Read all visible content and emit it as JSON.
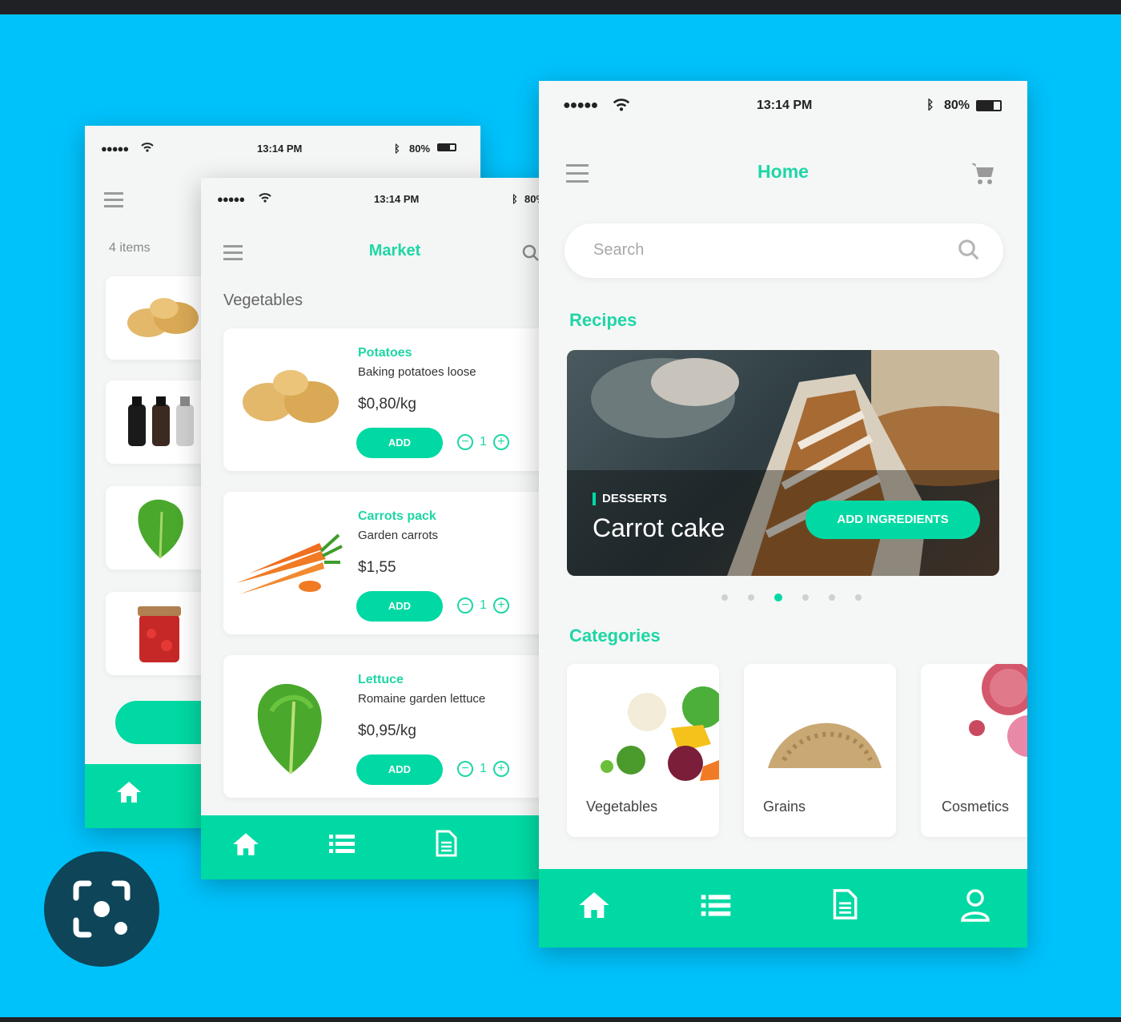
{
  "colors": {
    "accent": "#00d9a3",
    "background": "#00c2fb"
  },
  "status": {
    "time": "13:14 PM",
    "battery": "80%",
    "cell": "●●●●●"
  },
  "back": {
    "count": "4 items"
  },
  "market": {
    "title": "Market",
    "section": "Vegetables",
    "products": [
      {
        "name": "Potatoes",
        "desc": "Baking potatoes loose",
        "price": "$0,80/kg",
        "add": "ADD",
        "qty": "1"
      },
      {
        "name": "Carrots pack",
        "desc": "Garden carrots",
        "price": "$1,55",
        "add": "ADD",
        "qty": "1"
      },
      {
        "name": "Lettuce",
        "desc": "Romaine garden lettuce",
        "price": "$0,95/kg",
        "add": "ADD",
        "qty": "1"
      }
    ]
  },
  "home": {
    "title": "Home",
    "search_placeholder": "Search",
    "recipes_title": "Recipes",
    "recipe": {
      "tag": "DESSERTS",
      "name": "Carrot cake",
      "button": "ADD INGREDIENTS"
    },
    "carousel": {
      "count": 6,
      "active": 3
    },
    "categories_title": "Categories",
    "categories": [
      "Vegetables",
      "Grains",
      "Cosmetics"
    ]
  },
  "icons": [
    "home-icon",
    "list-icon",
    "document-icon",
    "user-icon",
    "cart-icon",
    "search-icon",
    "menu-icon",
    "camera-search-icon"
  ]
}
